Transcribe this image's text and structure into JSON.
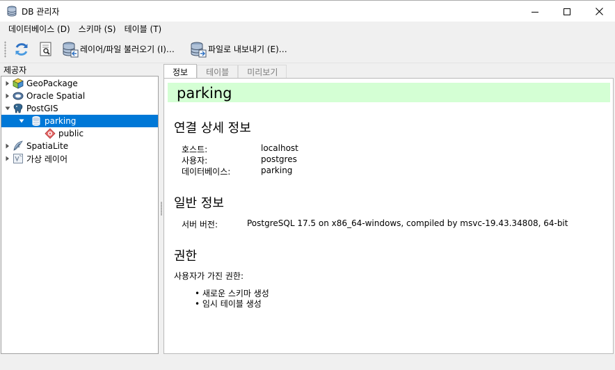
{
  "window": {
    "title": "DB 관리자",
    "controls": {
      "minimize": "minimize-icon",
      "maximize": "maximize-icon",
      "close": "close-icon"
    }
  },
  "menubar": {
    "items": [
      {
        "label": "데이터베이스 (D)"
      },
      {
        "label": "스키마 (S)"
      },
      {
        "label": "테이블 (T)"
      }
    ]
  },
  "toolbar": {
    "refresh_icon": "refresh-icon",
    "info_icon": "info-icon",
    "import_label": "레이어/파일 불러오기 (I)…",
    "export_label": "파일로 내보내기 (E)…"
  },
  "provider_panel": {
    "title": "제공자",
    "tree": [
      {
        "label": "GeoPackage",
        "icon": "geopackage-icon",
        "expanded": false
      },
      {
        "label": "Oracle Spatial",
        "icon": "oracle-icon",
        "expanded": false
      },
      {
        "label": "PostGIS",
        "icon": "postgis-elephant-icon",
        "expanded": true
      },
      {
        "label": "parking",
        "icon": "database-icon",
        "expanded": true,
        "selected": true
      },
      {
        "label": "public",
        "icon": "schema-icon"
      },
      {
        "label": "SpatiaLite",
        "icon": "spatialite-feather-icon",
        "expanded": false
      },
      {
        "label": "가상 레이어",
        "icon": "virtual-layer-icon",
        "expanded": false
      }
    ]
  },
  "tabs": [
    {
      "label": "정보",
      "active": true
    },
    {
      "label": "테이블",
      "active": false
    },
    {
      "label": "미리보기",
      "active": false
    }
  ],
  "info": {
    "title": "parking",
    "banner_color": "#d4ffd4",
    "connection_heading": "연결 상세 정보",
    "connection": [
      {
        "key": "호스트:",
        "value": "localhost"
      },
      {
        "key": "사용자:",
        "value": "postgres"
      },
      {
        "key": "데이터베이스:",
        "value": "parking"
      }
    ],
    "general_heading": "일반 정보",
    "server_version_key": "서버 버전:",
    "server_version_value": "PostgreSQL 17.5 on x86_64-windows, compiled by msvc-19.43.34808, 64-bit",
    "privileges_heading": "권한",
    "privileges_intro": "사용자가 가진 권한:",
    "privileges": [
      "• 새로운 스키마 생성",
      "• 임시 테이블 생성"
    ]
  },
  "colors": {
    "selection": "#0078d7",
    "window_bg": "#f0f0f0"
  }
}
